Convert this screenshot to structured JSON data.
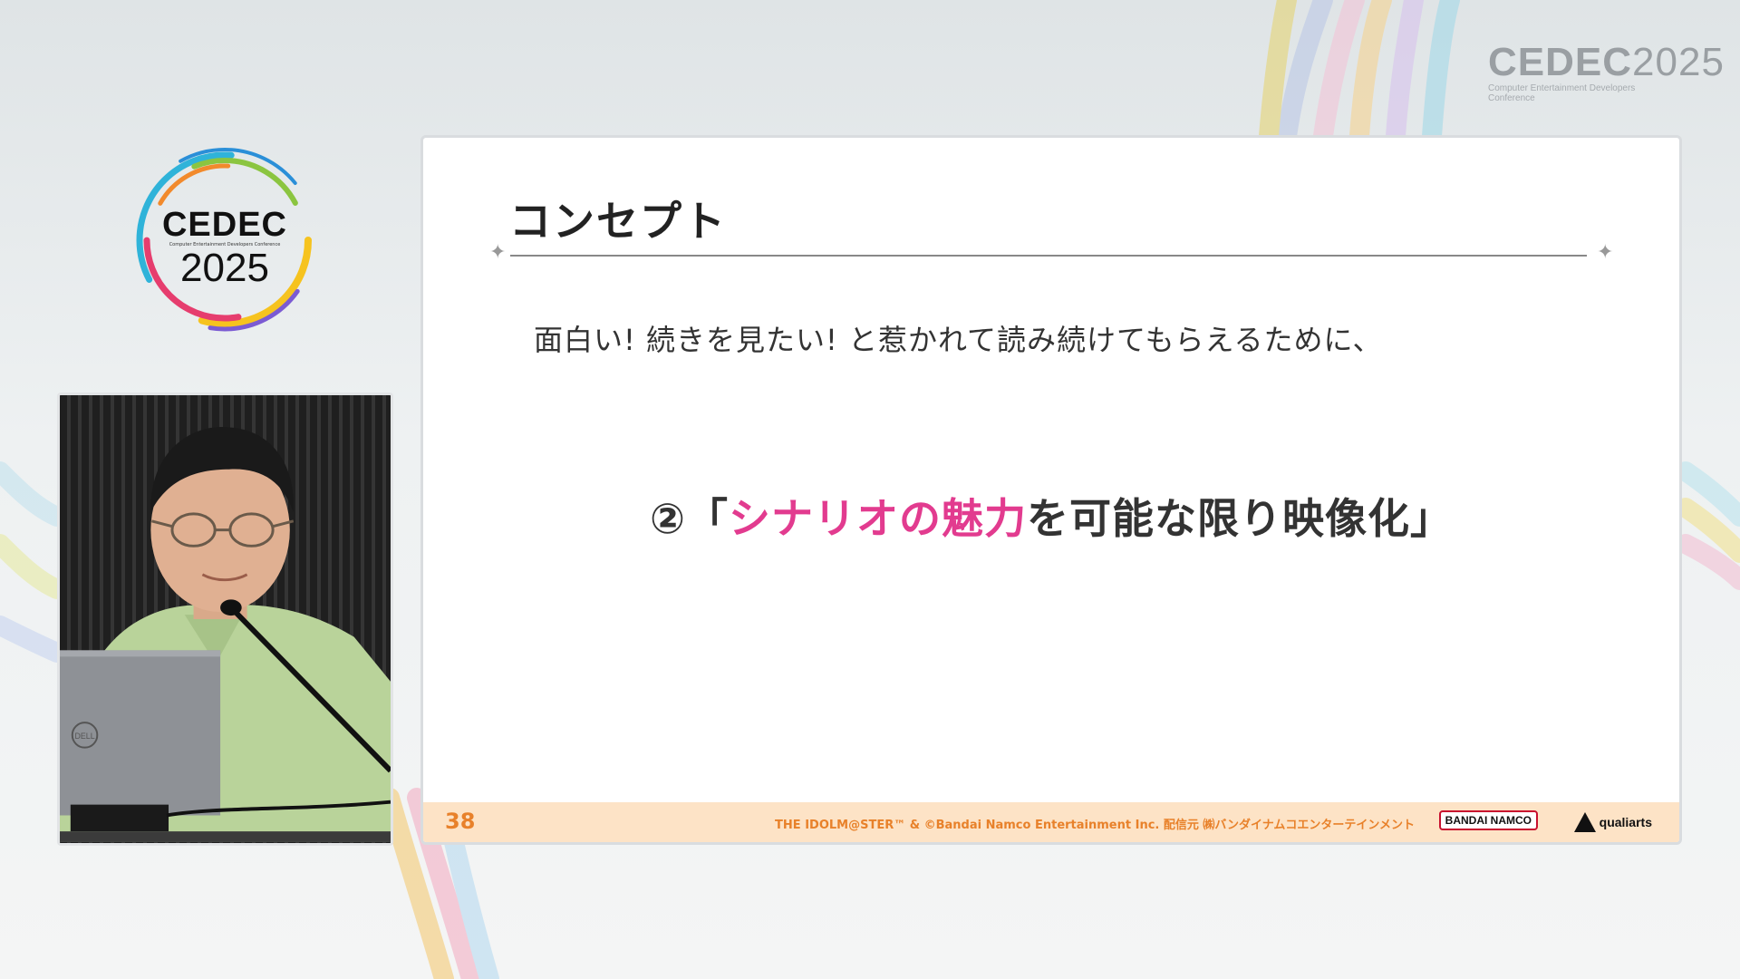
{
  "corner_logo": {
    "main": "CEDEC",
    "year": "2025",
    "subtitle": "Computer Entertainment Developers Conference"
  },
  "big_logo": {
    "main": "CEDEC",
    "subtitle": "Computer Entertainment Developers Conference",
    "year": "2025"
  },
  "slide": {
    "title": "コンセプト",
    "lead": "面白い! 続きを見たい!  と惹かれて読み続けてもらえるために、",
    "point_prefix": "②「",
    "point_highlight": "シナリオの魅力",
    "point_suffix": "を可能な限り映像化」",
    "highlight_color": "#e23b8f",
    "page_number": "38",
    "copyright": "THE IDOLM@STER™ & ©Bandai Namco Entertainment Inc.  配信元 ㈱バンダイナムコエンターテインメント",
    "sponsor_1": "BANDAI NAMCO",
    "sponsor_2": "qualiarts"
  },
  "video": {
    "laptop_badge": "DELL"
  }
}
